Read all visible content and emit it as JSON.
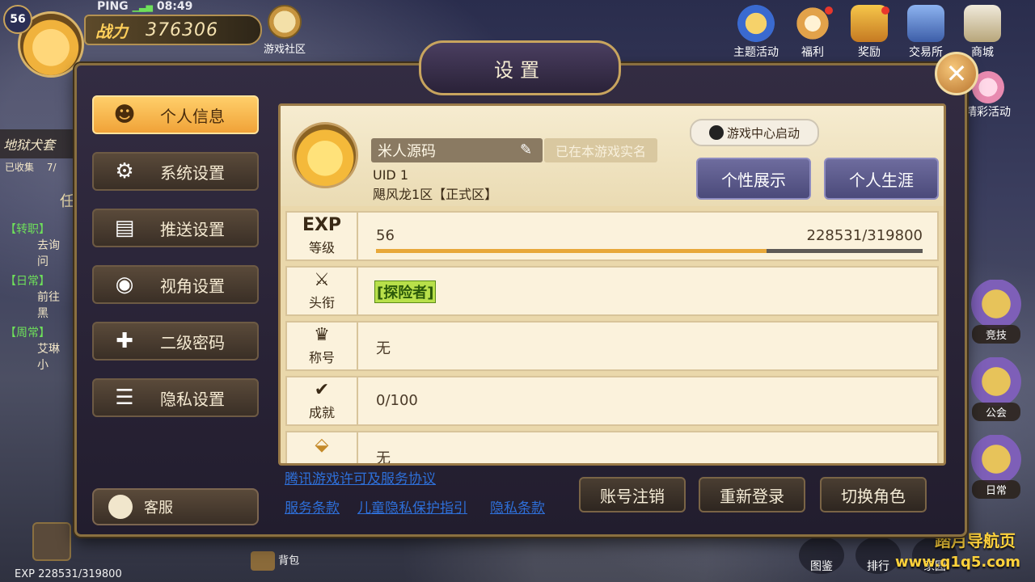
{
  "hud": {
    "level": "56",
    "ping": "PING",
    "time": "08:49",
    "power_label": "战力",
    "power_value": "376306",
    "community": "游戏社区",
    "top_right": [
      "主题活动",
      "福利",
      "奖励",
      "交易所",
      "商城"
    ],
    "wonderful": "精彩活动",
    "quest": {
      "title": "地狱犬套",
      "collected": "已收集",
      "collected_val": "7/",
      "tab": "任",
      "rows": [
        {
          "tag": "【转职】",
          "desc": "去询问"
        },
        {
          "tag": "【日常】",
          "desc": "前往黑"
        },
        {
          "tag": "【周常】",
          "desc": "艾琳小"
        }
      ]
    },
    "right_side": [
      "竞技",
      "公会",
      "日常"
    ],
    "bottom_exp": "EXP  228531/319800",
    "bag": "背包",
    "bottom_right": [
      "图鉴",
      "排行",
      "家园"
    ],
    "watermark1": "踏月导航页",
    "watermark2": "www.q1q5.com"
  },
  "dialog": {
    "title": "设置",
    "close": "✕",
    "menu": [
      {
        "label": "个人信息",
        "icon": "person-icon"
      },
      {
        "label": "系统设置",
        "icon": "gear-icon"
      },
      {
        "label": "推送设置",
        "icon": "message-icon"
      },
      {
        "label": "视角设置",
        "icon": "eye-icon"
      },
      {
        "label": "二级密码",
        "icon": "shield-icon"
      },
      {
        "label": "隐私设置",
        "icon": "list-icon"
      }
    ],
    "service": "客服",
    "profile": {
      "name": "米人源码",
      "realname": "已在本游戏实名",
      "uid": "UID 1",
      "server": "飓风龙1区【正式区】",
      "qq_launch": "游戏中心启动",
      "btn_show": "个性展示",
      "btn_career": "个人生涯"
    },
    "stats": {
      "exp_icon": "EXP",
      "level_label": "等级",
      "level_value": "56",
      "exp_count": "228531/319800",
      "exp_progress": 0.7145,
      "title_label": "头衔",
      "title_value": "[探险者]",
      "honor_label": "称号",
      "honor_value": "无",
      "achieve_label": "成就",
      "achieve_value": "0/100",
      "extra_value": "无"
    },
    "links": {
      "license": "腾讯游戏许可及服务协议",
      "terms": "服务条款",
      "child": "儿童隐私保护指引",
      "privacy": "隐私条款"
    },
    "actions": {
      "cancel_account": "账号注销",
      "relogin": "重新登录",
      "switch_role": "切换角色"
    }
  }
}
